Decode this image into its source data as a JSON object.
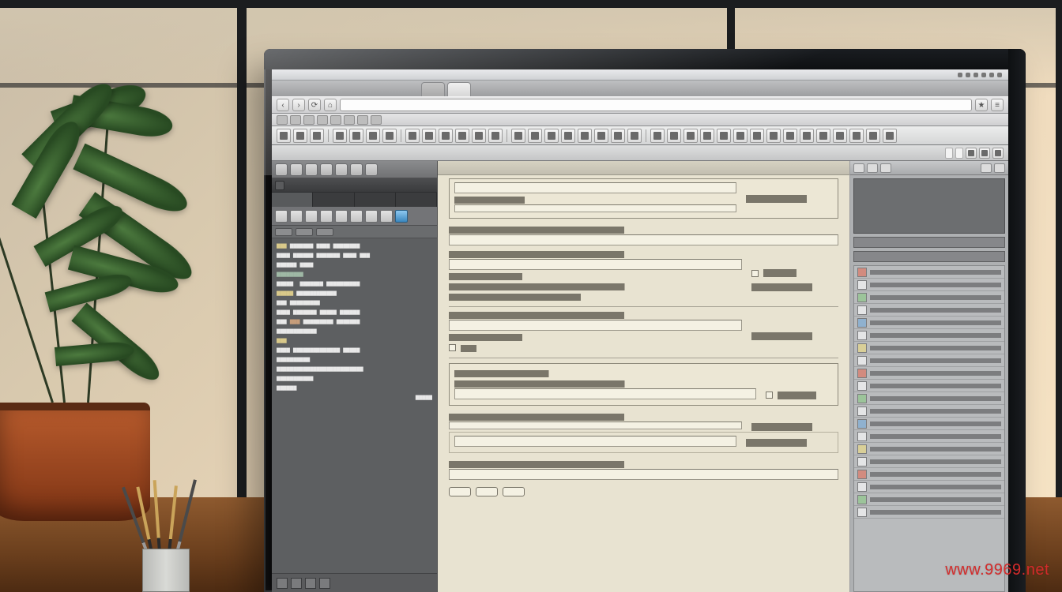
{
  "watermark": "www.9969.net",
  "browser": {
    "tabs": [
      "",
      ""
    ],
    "address": ""
  },
  "leftPanel": {
    "title": "",
    "tabs": [
      "",
      "",
      "",
      ""
    ]
  }
}
